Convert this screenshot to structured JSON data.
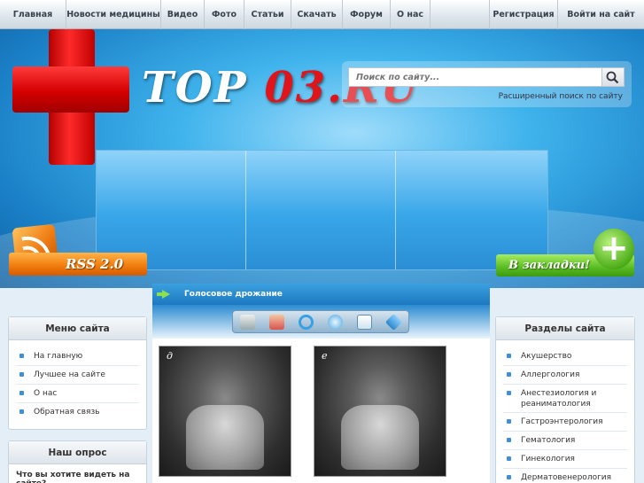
{
  "nav": {
    "items": [
      "Главная",
      "Новости медицины",
      "Видео",
      "Фото",
      "Статьи",
      "Скачать",
      "Форум",
      "О нас"
    ],
    "right": [
      "Регистрация",
      "Войти на сайт"
    ]
  },
  "logo": {
    "text_part1": "TOP ",
    "text_part2": "03.RU"
  },
  "search": {
    "placeholder": "Поиск по сайту...",
    "advanced_label": "Расширенный поиск по сайту"
  },
  "rss": {
    "label": "RSS 2.0"
  },
  "bookmarks": {
    "label": "В закладки!"
  },
  "menu": {
    "title": "Меню сайта",
    "items": [
      "На главную",
      "Лучшее на сайте",
      "О нас",
      "Обратная связь"
    ]
  },
  "poll": {
    "title": "Наш опрос",
    "question": "Что вы хотите видеть на сайте?"
  },
  "article": {
    "title": "Голосовое дрожание",
    "photo_labels": [
      "д",
      "е"
    ]
  },
  "sections": {
    "title": "Разделы сайта",
    "items": [
      "Акушерство",
      "Аллергология",
      "Анестезиология и реаниматология",
      "Гастроэнтерология",
      "Гематология",
      "Гинекология",
      "Дерматовенерология"
    ]
  },
  "toolbar_icons": [
    "print-icon",
    "user-icon",
    "refresh-icon",
    "comment-icon",
    "window-icon",
    "tag-icon"
  ],
  "colors": {
    "accent_blue": "#1d78c0",
    "brand_red": "#e0141b",
    "rss_orange": "#f07a0c",
    "bookmark_green": "#58bb22"
  }
}
